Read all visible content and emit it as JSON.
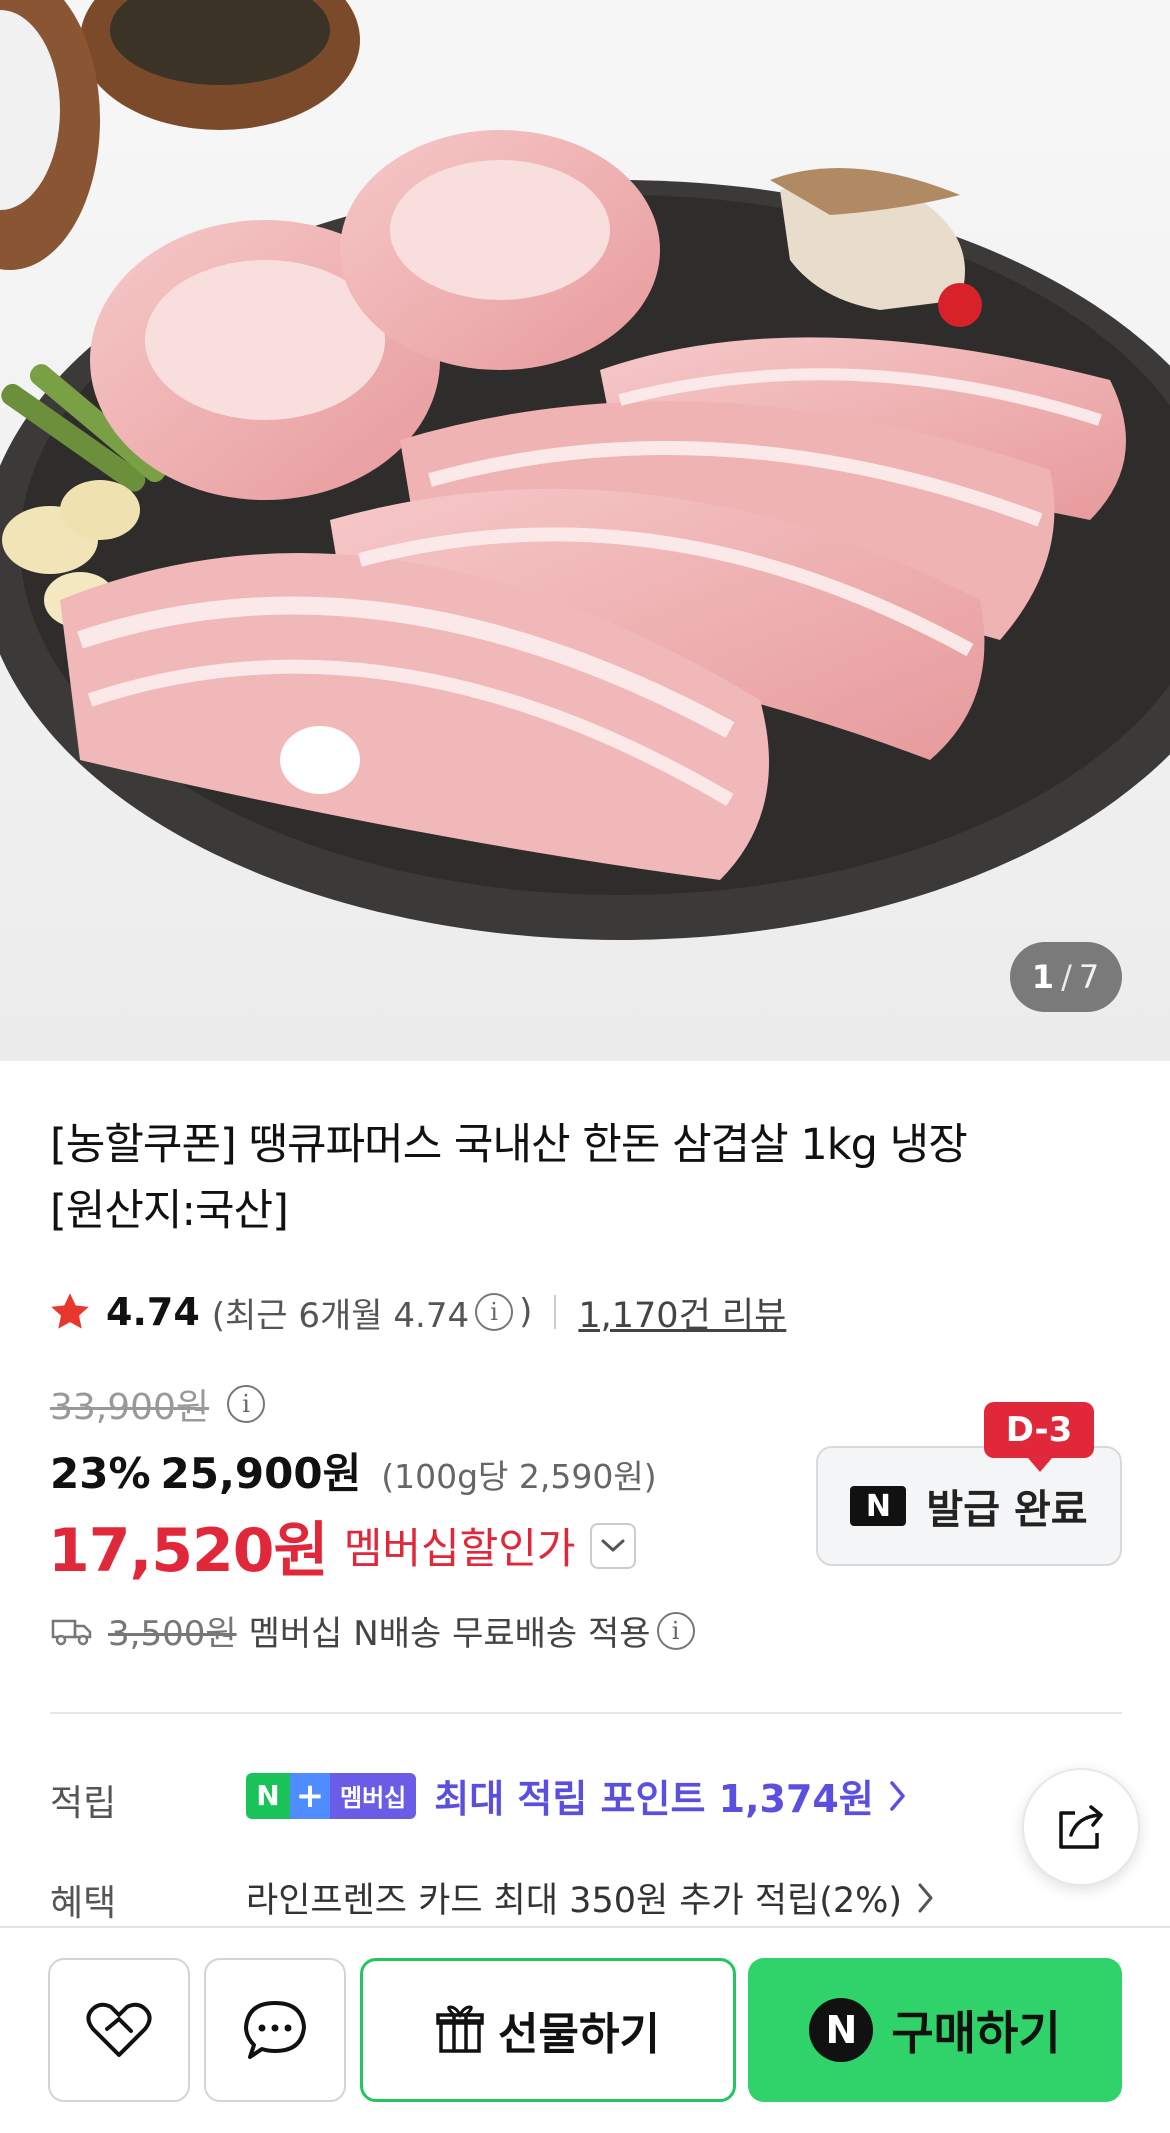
{
  "hero": {
    "page_current": "1",
    "page_separator": "/",
    "page_total": "7"
  },
  "product": {
    "title_line1": "[농할쿠폰] 땡큐파머스 국내산 한돈 삼겹살 1kg 냉장",
    "title_line2": "[원산지:국산]"
  },
  "rating": {
    "value": "4.74",
    "recent_prefix": "(최근 6개월 4.74",
    "recent_suffix": ")",
    "info_glyph": "i",
    "review_count": "1,170건 리뷰"
  },
  "price": {
    "original": "33,900원",
    "discount_rate": "23%",
    "sale": "25,900원",
    "unit": "(100g당 2,590원)",
    "member_price": "17,520원",
    "member_label": "멤버십할인가"
  },
  "coupon": {
    "badge": "D-3",
    "logo": "N",
    "label": "발급 완료"
  },
  "delivery": {
    "original_fee": "3,500원",
    "text": "멤버십 N배송 무료배송 적용"
  },
  "points": {
    "label": "적립",
    "badge_n": "N",
    "badge_plus": "+",
    "badge_member": "멤버십",
    "text": "최대 적립 포인트 1,374원"
  },
  "benefit": {
    "label": "혜택",
    "text": "라인프렌즈 카드 최대 350원 추가 적립(2%)"
  },
  "bottom": {
    "gift_label": "선물하기",
    "buy_logo": "N",
    "buy_label": "구매하기"
  },
  "colors": {
    "accent_red": "#e0283a",
    "naver_green": "#2fd36a",
    "points_purple": "#5b4fe0"
  },
  "icons": [
    "star-icon",
    "info-icon",
    "chevron-down-icon",
    "truck-icon",
    "chevron-right-icon",
    "share-icon",
    "heart-icon",
    "chat-icon",
    "gift-icon"
  ]
}
